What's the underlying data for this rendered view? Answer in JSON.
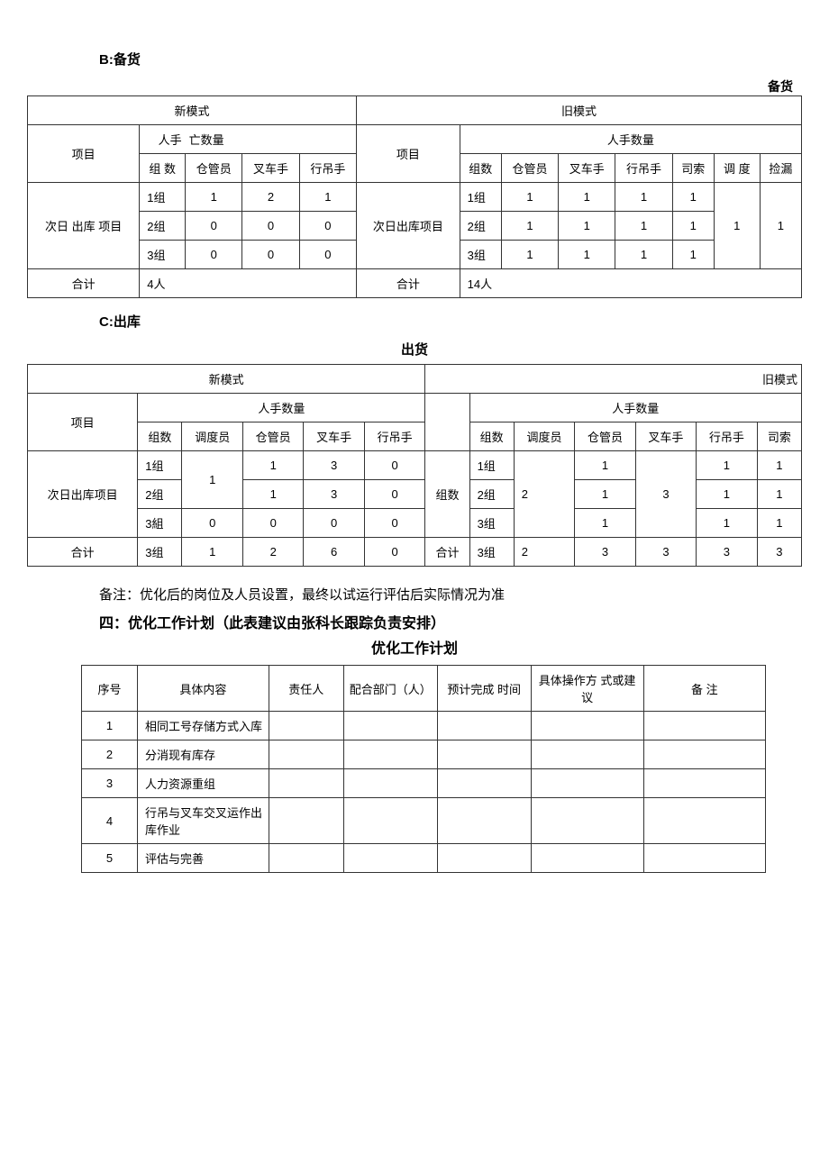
{
  "sectionB": {
    "title": "B:备货",
    "topRightLabel": "备货",
    "headers": {
      "newMode": "新模式",
      "oldMode": "旧模式",
      "headcountPartial": "亡数量",
      "headcountLeft": "人手",
      "headcountFull": "人手数量",
      "project": "项目",
      "groupNum": "组 数",
      "groupNum2": "组数",
      "warehouse": "仓管员",
      "forklift": "叉车手",
      "crane": "行吊手",
      "sisuo": "司索",
      "dispatch": "调 度",
      "leak": "捡漏",
      "nextDayOut": "次日 出库 项目",
      "nextDayOut2": "次日出库项目",
      "total": "合计"
    },
    "newRows": [
      {
        "g": "1组",
        "cg": "1",
        "cc": "2",
        "xd": "1"
      },
      {
        "g": "2组",
        "cg": "0",
        "cc": "0",
        "xd": "0"
      },
      {
        "g": "3组",
        "cg": "0",
        "cc": "0",
        "xd": "0"
      }
    ],
    "oldRows": [
      {
        "g": "1组",
        "cg": "1",
        "cc": "1",
        "xd": "1",
        "ss": "1"
      },
      {
        "g": "2组",
        "cg": "1",
        "cc": "1",
        "xd": "1",
        "ss": "1"
      },
      {
        "g": "3组",
        "cg": "1",
        "cc": "1",
        "xd": "1",
        "ss": "1"
      }
    ],
    "oldDispatch": "1",
    "oldLeak": "1",
    "newTotal": "4人",
    "oldTotal": "14人"
  },
  "sectionC": {
    "title": "C:出库",
    "centerTitle": "出货",
    "newModeLabel": "新模式",
    "oldModeLabel": "旧模式",
    "headers": {
      "project": "项目",
      "headcount": "人手数量",
      "groupNum": "组数",
      "dispatch": "调度员",
      "warehouse": "仓管员",
      "forklift": "叉车手",
      "crane": "行吊手",
      "sisuo": "司索",
      "nextDayOut": "次日出库项目",
      "groupLabel": "组数",
      "total": "合计"
    },
    "newRows": [
      {
        "g": "1组",
        "cg": "1",
        "cc": "3",
        "xd": "0"
      },
      {
        "g": "2组",
        "cg": "1",
        "cc": "3",
        "xd": "0"
      },
      {
        "g": "3組",
        "dd": "0",
        "cg": "0",
        "cc": "0",
        "xd": "0"
      }
    ],
    "newDispatchMerged": "1",
    "oldRows": [
      {
        "g": "1组",
        "cg": "1",
        "xd": "1",
        "ss": "1"
      },
      {
        "g": "2组",
        "cg": "1",
        "xd": "1",
        "ss": "1"
      },
      {
        "g": "3组",
        "cg": "1",
        "xd": "1",
        "ss": "1"
      }
    ],
    "oldDispatchMerged": "2",
    "oldForkliftMerged": "3",
    "newTotalRow": {
      "g": "3组",
      "dd": "1",
      "cg": "2",
      "cc": "6",
      "xd": "0"
    },
    "oldTotalRow": {
      "g": "3组",
      "dd": "2",
      "cg": "3",
      "cc": "3",
      "xd": "3",
      "ss": "3"
    }
  },
  "note": "备注：优化后的岗位及人员设置，最终以试运行评估后实际情况为准",
  "section4Title": "四：优化工作计划（此表建议由张科长跟踪负责安排）",
  "planTitle": "优化工作计划",
  "planHeaders": {
    "seq": "序号",
    "content": "具体内容",
    "responsible": "责任人",
    "coopDept": "配合部门（人）",
    "estTime": "预计完成 时间",
    "method": "具体操作方 式或建议",
    "remark": "备        注"
  },
  "planRows": [
    {
      "seq": "1",
      "content": "相同工号存储方式入库"
    },
    {
      "seq": "2",
      "content": "分消现有库存"
    },
    {
      "seq": "3",
      "content": "人力资源重组"
    },
    {
      "seq": "4",
      "content": "行吊与叉车交叉运作出库作业"
    },
    {
      "seq": "5",
      "content": "评估与完善"
    }
  ]
}
